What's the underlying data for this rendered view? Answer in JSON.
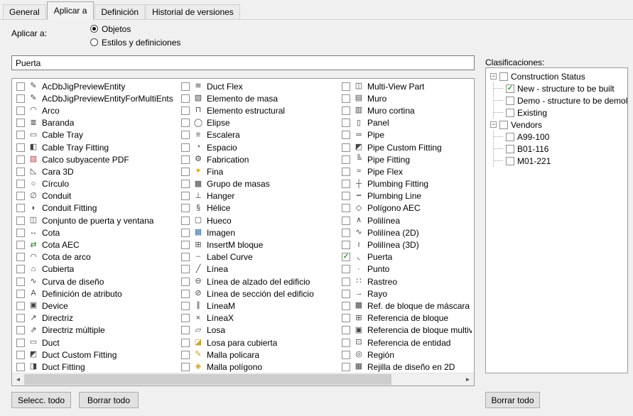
{
  "tabs": {
    "items": [
      {
        "label": "General",
        "active": false
      },
      {
        "label": "Aplicar a",
        "active": true
      },
      {
        "label": "Definición",
        "active": false
      },
      {
        "label": "Historial de versiones",
        "active": false
      }
    ]
  },
  "apply_to": {
    "label": "Aplicar a:",
    "radios": [
      {
        "label": "Objetos",
        "selected": true
      },
      {
        "label": "Estilos y definiciones",
        "selected": false
      }
    ]
  },
  "filter": {
    "value": "Puerta"
  },
  "object_list": {
    "columns": [
      {
        "items": [
          {
            "label": "AcDbJigPreviewEntity",
            "icon": "pencil-icon",
            "glyph": "✎"
          },
          {
            "label": "AcDbJigPreviewEntityForMultiEnts",
            "icon": "pencil-icon",
            "glyph": "✎"
          },
          {
            "label": "Arco",
            "icon": "arc-icon",
            "glyph": "◠"
          },
          {
            "label": "Baranda",
            "icon": "railing-icon",
            "glyph": "≣"
          },
          {
            "label": "Cable Tray",
            "icon": "cable-tray-icon",
            "glyph": "▭"
          },
          {
            "label": "Cable Tray Fitting",
            "icon": "cable-tray-fitting-icon",
            "glyph": "◧"
          },
          {
            "label": "Calco subyacente PDF",
            "icon": "pdf-underlay-icon",
            "glyph": "▨",
            "color": "#b24040"
          },
          {
            "label": "Cara 3D",
            "icon": "face-3d-icon",
            "glyph": "◺"
          },
          {
            "label": "Círculo",
            "icon": "circle-icon",
            "glyph": "○"
          },
          {
            "label": "Conduit",
            "icon": "conduit-icon",
            "glyph": "∅"
          },
          {
            "label": "Conduit Fitting",
            "icon": "conduit-fitting-icon",
            "glyph": "◗"
          },
          {
            "label": "Conjunto de puerta y ventana",
            "icon": "door-window-assembly-icon",
            "glyph": "◫"
          },
          {
            "label": "Cota",
            "icon": "dimension-icon",
            "glyph": "↔"
          },
          {
            "label": "Cota AEC",
            "icon": "aec-dimension-icon",
            "glyph": "⇄",
            "color": "#3a7a3a"
          },
          {
            "label": "Cota de arco",
            "icon": "arc-dimension-icon",
            "glyph": "◠"
          },
          {
            "label": "Cubierta",
            "icon": "roof-icon",
            "glyph": "⌂"
          },
          {
            "label": "Curva de diseño",
            "icon": "design-curve-icon",
            "glyph": "∿"
          },
          {
            "label": "Definición de atributo",
            "icon": "attribute-definition-icon",
            "glyph": "A"
          },
          {
            "label": "Device",
            "icon": "device-icon",
            "glyph": "▣"
          },
          {
            "label": "Directriz",
            "icon": "leader-icon",
            "glyph": "↗"
          },
          {
            "label": "Directriz múltiple",
            "icon": "multileader-icon",
            "glyph": "⇗"
          },
          {
            "label": "Duct",
            "icon": "duct-icon",
            "glyph": "▭"
          },
          {
            "label": "Duct Custom Fitting",
            "icon": "duct-custom-fitting-icon",
            "glyph": "◩"
          },
          {
            "label": "Duct Fitting",
            "icon": "duct-fitting-icon",
            "glyph": "◨"
          }
        ]
      },
      {
        "items": [
          {
            "label": "Duct Flex",
            "icon": "duct-flex-icon",
            "glyph": "≋"
          },
          {
            "label": "Elemento de masa",
            "icon": "mass-element-icon",
            "glyph": "▧"
          },
          {
            "label": "Elemento estructural",
            "icon": "structural-member-icon",
            "glyph": "⊓"
          },
          {
            "label": "Elipse",
            "icon": "ellipse-icon",
            "glyph": "◯"
          },
          {
            "label": "Escalera",
            "icon": "stair-icon",
            "glyph": "≡"
          },
          {
            "label": "Espacio",
            "icon": "space-icon",
            "glyph": "◔"
          },
          {
            "label": "Fabrication",
            "icon": "fabrication-icon",
            "glyph": "⚙"
          },
          {
            "label": "Fina",
            "icon": "fixture-icon",
            "glyph": "✦",
            "color": "#d9a300"
          },
          {
            "label": "Grupo de masas",
            "icon": "mass-group-icon",
            "glyph": "▩"
          },
          {
            "label": "Hanger",
            "icon": "hanger-icon",
            "glyph": "⊥"
          },
          {
            "label": "Hélice",
            "icon": "helix-icon",
            "glyph": "§"
          },
          {
            "label": "Hueco",
            "icon": "opening-icon",
            "glyph": "▢"
          },
          {
            "label": "Imagen",
            "icon": "image-icon",
            "glyph": "▦",
            "color": "#3a6ea5"
          },
          {
            "label": "InsertM bloque",
            "icon": "block-insert-icon",
            "glyph": "⊞"
          },
          {
            "label": "Label Curve",
            "icon": "label-curve-icon",
            "glyph": "┄"
          },
          {
            "label": "Línea",
            "icon": "line-icon",
            "glyph": "╱"
          },
          {
            "label": "Línea de alzado del edificio",
            "icon": "elevation-line-icon",
            "glyph": "⊖"
          },
          {
            "label": "Línea de sección del edificio",
            "icon": "section-line-icon",
            "glyph": "⊘"
          },
          {
            "label": "LíneaM",
            "icon": "mline-icon",
            "glyph": "∥"
          },
          {
            "label": "LíneaX",
            "icon": "xline-icon",
            "glyph": "×"
          },
          {
            "label": "Losa",
            "icon": "slab-icon",
            "glyph": "▱"
          },
          {
            "label": "Losa para cubierta",
            "icon": "roof-slab-icon",
            "glyph": "◪",
            "color": "#c9a227"
          },
          {
            "label": "Malla policara",
            "icon": "polyface-mesh-icon",
            "glyph": "✎",
            "color": "#c9a227"
          },
          {
            "label": "Malla polígono",
            "icon": "polygon-mesh-icon",
            "glyph": "◈",
            "color": "#c9a227"
          }
        ]
      },
      {
        "items": [
          {
            "label": "Multi-View Part",
            "icon": "multi-view-part-icon",
            "glyph": "◫"
          },
          {
            "label": "Muro",
            "icon": "wall-icon",
            "glyph": "▤"
          },
          {
            "label": "Muro cortina",
            "icon": "curtain-wall-icon",
            "glyph": "▥"
          },
          {
            "label": "Panel",
            "icon": "panel-icon",
            "glyph": "▯"
          },
          {
            "label": "Pipe",
            "icon": "pipe-icon",
            "glyph": "═"
          },
          {
            "label": "Pipe Custom Fitting",
            "icon": "pipe-custom-fitting-icon",
            "glyph": "◩"
          },
          {
            "label": "Pipe Fitting",
            "icon": "pipe-fitting-icon",
            "glyph": "╚"
          },
          {
            "label": "Pipe Flex",
            "icon": "pipe-flex-icon",
            "glyph": "≈"
          },
          {
            "label": "Plumbing Fitting",
            "icon": "plumbing-fitting-icon",
            "glyph": "┼"
          },
          {
            "label": "Plumbing Line",
            "icon": "plumbing-line-icon",
            "glyph": "┅"
          },
          {
            "label": "Polígono AEC",
            "icon": "aec-polygon-icon",
            "glyph": "◇"
          },
          {
            "label": "Polilínea",
            "icon": "polyline-icon",
            "glyph": "∧"
          },
          {
            "label": "Polilínea (2D)",
            "icon": "polyline-2d-icon",
            "glyph": "∿"
          },
          {
            "label": "Polilínea (3D)",
            "icon": "polyline-3d-icon",
            "glyph": "≀"
          },
          {
            "label": "Puerta",
            "icon": "door-icon",
            "glyph": "◟",
            "checked": true
          },
          {
            "label": "Punto",
            "icon": "point-icon",
            "glyph": "∙"
          },
          {
            "label": "Rastreo",
            "icon": "tracking-icon",
            "glyph": "∷"
          },
          {
            "label": "Rayo",
            "icon": "ray-icon",
            "glyph": "→"
          },
          {
            "label": "Ref. de bloque de máscara",
            "icon": "wipeout-icon",
            "glyph": "▩"
          },
          {
            "label": "Referencia de bloque",
            "icon": "block-reference-icon",
            "glyph": "⊞"
          },
          {
            "label": "Referencia de bloque multivis",
            "icon": "multiview-block-icon",
            "glyph": "▣"
          },
          {
            "label": "Referencia de entidad",
            "icon": "entity-reference-icon",
            "glyph": "⊡"
          },
          {
            "label": "Región",
            "icon": "region-icon",
            "glyph": "◎"
          },
          {
            "label": "Rejilla de diseño en 2D",
            "icon": "layout-grid-icon",
            "glyph": "▦"
          }
        ]
      }
    ]
  },
  "actions": {
    "select_all": "Selecc. todo",
    "clear_all": "Borrar todo",
    "clear_all_right": "Borrar todo"
  },
  "classifications": {
    "label": "Clasificaciones:",
    "tree": [
      {
        "label": "Construction Status",
        "checked": false,
        "expanded": true,
        "children": [
          {
            "label": "New - structure to be built",
            "checked": true
          },
          {
            "label": "Demo - structure to be demoli",
            "checked": false
          },
          {
            "label": "Existing",
            "checked": false
          }
        ]
      },
      {
        "label": "Vendors",
        "checked": false,
        "expanded": true,
        "children": [
          {
            "label": "A99-100",
            "checked": false
          },
          {
            "label": "B01-116",
            "checked": false
          },
          {
            "label": "M01-221",
            "checked": false
          }
        ]
      }
    ]
  },
  "colors": {
    "check_green": "#2ca02c",
    "icon_default": "#444444",
    "panel_bg": "#f0f0f0"
  }
}
